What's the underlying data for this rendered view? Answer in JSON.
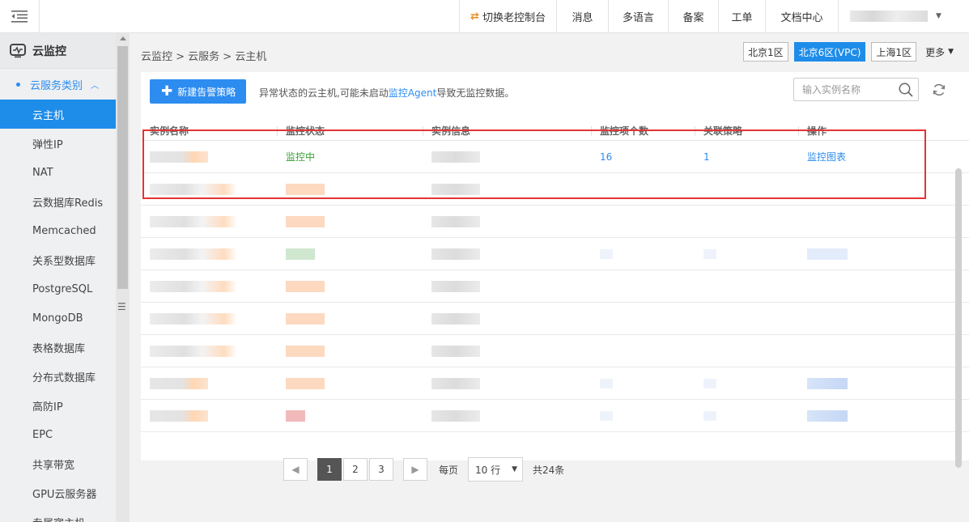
{
  "topbar": {
    "switch_label": "切换老控制台",
    "nav": [
      "消息",
      "多语言",
      "备案",
      "工单",
      "文档中心"
    ]
  },
  "sidebar": {
    "title": "云监控",
    "group_label": "云服务类别",
    "items": [
      "云主机",
      "弹性IP",
      "NAT",
      "云数据库Redis",
      "Memcached",
      "关系型数据库",
      "PostgreSQL",
      "MongoDB",
      "表格数据库",
      "分布式数据库",
      "高防IP",
      "EPC",
      "共享带宽",
      "GPU云服务器",
      "专属宿主机"
    ],
    "active_index": 0
  },
  "main": {
    "breadcrumb": "云监控 > 云服务 > 云主机",
    "regions": [
      "北京1区",
      "北京6区(VPC)",
      "上海1区"
    ],
    "active_region": 1,
    "more_label": "更多",
    "new_button_label": "新建告警策略",
    "notice_prefix": "异常状态的云主机,可能未启动",
    "notice_link": "监控Agent",
    "notice_suffix": "导致无监控数据。",
    "search_placeholder": "输入实例名称",
    "columns": [
      "实例名称",
      "监控状态",
      "实例信息",
      "监控项个数",
      "关联策略",
      "操作"
    ],
    "first_row": {
      "status": "监控中",
      "metric_count": "16",
      "policy_count": "1",
      "action": "监控图表"
    }
  },
  "pagination": {
    "pages": [
      "1",
      "2",
      "3"
    ],
    "active_page": 0,
    "per_page_label": "每页",
    "page_size": "10 行",
    "total": "共24条"
  },
  "colors": {
    "accent": "#1e8ce9",
    "status_ok": "#3aa137",
    "highlight": "#e53333"
  }
}
